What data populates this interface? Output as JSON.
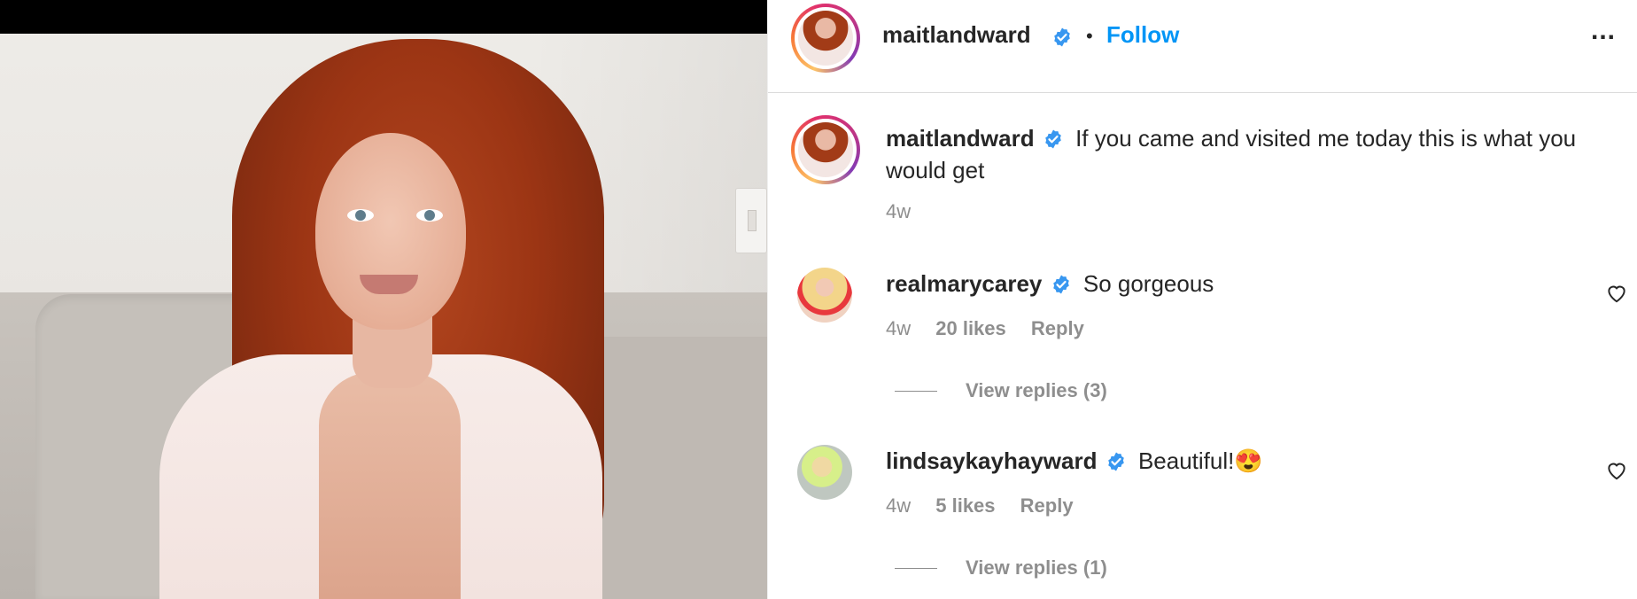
{
  "post": {
    "author": "maitlandward",
    "follow_label": "Follow",
    "separator": "•",
    "more_label": "..."
  },
  "caption": {
    "author": "maitlandward",
    "text": "If you came and visited me today this is what you would get",
    "time": "4w"
  },
  "comments": [
    {
      "author": "realmarycarey",
      "text": "So gorgeous",
      "time": "4w",
      "likes": "20 likes",
      "reply_label": "Reply",
      "view_replies": "View replies (3)"
    },
    {
      "author": "lindsaykayhayward",
      "text": "Beautiful!",
      "emoji": "😍",
      "time": "4w",
      "likes": "5 likes",
      "reply_label": "Reply",
      "view_replies": "View replies (1)"
    }
  ],
  "colors": {
    "follow_blue": "#0095f6",
    "verified_blue": "#3897f0",
    "meta_gray": "#8e8e8e",
    "text_dark": "#262626"
  },
  "icons": [
    "verified-badge-icon",
    "heart-icon",
    "more-options-icon"
  ]
}
